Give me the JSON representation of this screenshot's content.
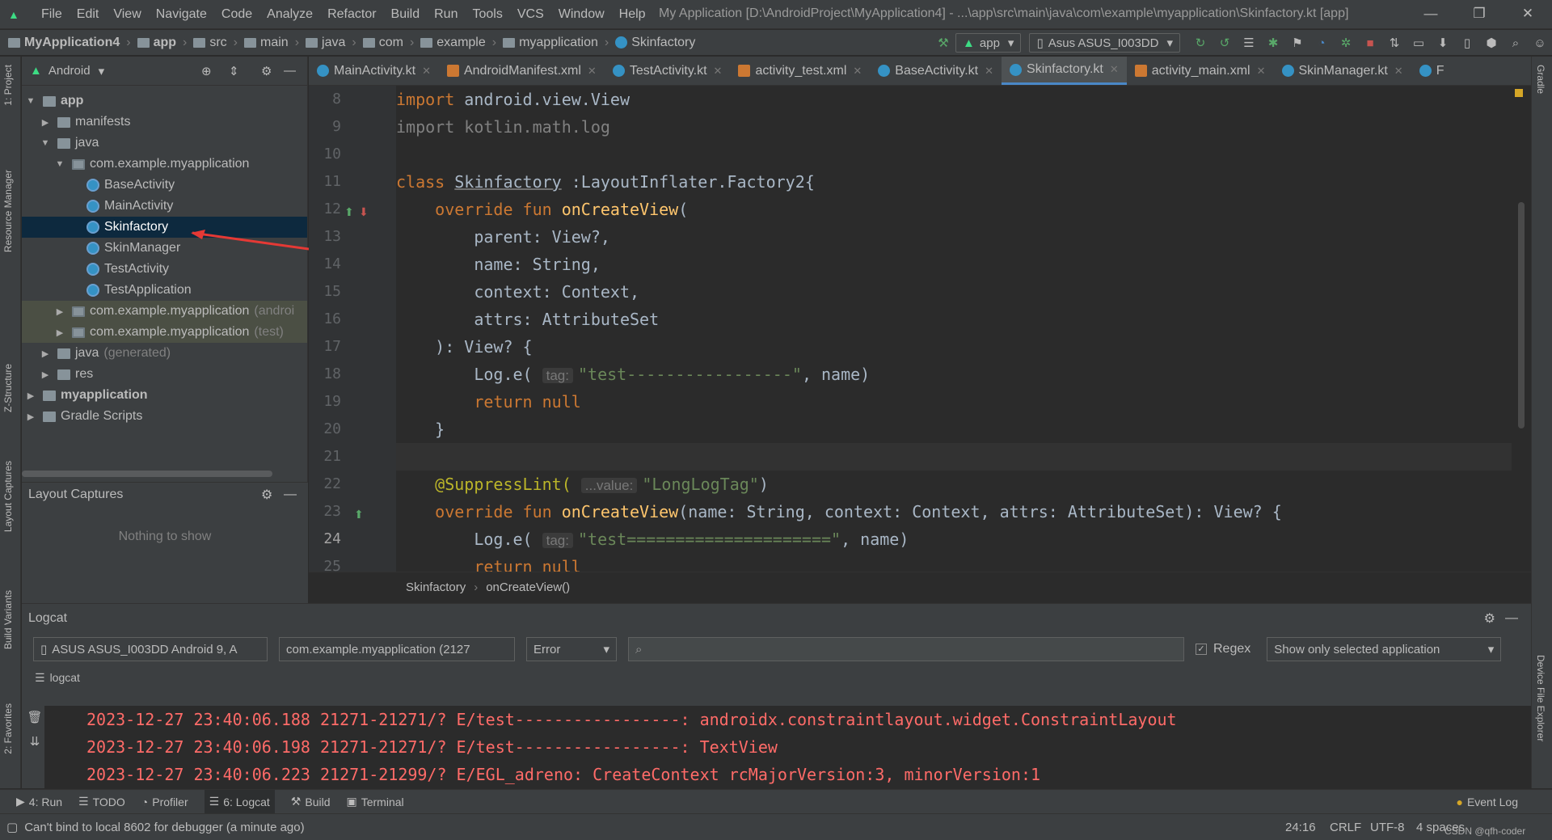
{
  "menu": [
    "File",
    "Edit",
    "View",
    "Navigate",
    "Code",
    "Analyze",
    "Refactor",
    "Build",
    "Run",
    "Tools",
    "VCS",
    "Window",
    "Help"
  ],
  "window_title": "My Application [D:\\AndroidProject\\MyApplication4] - ...\\app\\src\\main\\java\\com\\example\\myapplication\\Skinfactory.kt [app]",
  "nav": [
    "MyApplication4",
    "app",
    "src",
    "main",
    "java",
    "com",
    "example",
    "myapplication",
    "Skinfactory"
  ],
  "toolbar": {
    "run_config": "app",
    "device": "Asus ASUS_I003DD"
  },
  "project": {
    "view_label": "Android",
    "tree": [
      {
        "label": "app",
        "level": 0,
        "arrow": "▼",
        "icon": "fold",
        "bold": true
      },
      {
        "label": "manifests",
        "level": 1,
        "arrow": "▶",
        "icon": "fold"
      },
      {
        "label": "java",
        "level": 1,
        "arrow": "▼",
        "icon": "fold"
      },
      {
        "label": "com.example.myapplication",
        "level": 2,
        "arrow": "▼",
        "icon": "pkg"
      },
      {
        "label": "BaseActivity",
        "level": 3,
        "arrow": "",
        "icon": "cls"
      },
      {
        "label": "MainActivity",
        "level": 3,
        "arrow": "",
        "icon": "cls"
      },
      {
        "label": "Skinfactory",
        "level": 3,
        "arrow": "",
        "icon": "cls",
        "selected": true
      },
      {
        "label": "SkinManager",
        "level": 3,
        "arrow": "",
        "icon": "cls"
      },
      {
        "label": "TestActivity",
        "level": 3,
        "arrow": "",
        "icon": "cls"
      },
      {
        "label": "TestApplication",
        "level": 3,
        "arrow": "",
        "icon": "cls"
      },
      {
        "label": "com.example.myapplication",
        "suffix": "(androi",
        "level": 2,
        "arrow": "▶",
        "icon": "pkg",
        "hl": true
      },
      {
        "label": "com.example.myapplication",
        "suffix": "(test)",
        "level": 2,
        "arrow": "▶",
        "icon": "pkg",
        "hl": true
      },
      {
        "label": "java",
        "suffix": "(generated)",
        "level": 1,
        "arrow": "▶",
        "icon": "fold"
      },
      {
        "label": "res",
        "level": 1,
        "arrow": "▶",
        "icon": "fold"
      },
      {
        "label": "myapplication",
        "level": 0,
        "arrow": "▶",
        "icon": "fold",
        "bold": true
      },
      {
        "label": "Gradle Scripts",
        "level": 0,
        "arrow": "▶",
        "icon": "fold"
      }
    ]
  },
  "captures": {
    "title": "Layout Captures",
    "empty": "Nothing to show"
  },
  "left_tabs": [
    "1: Project",
    "Resource Manager",
    "Z-Structure",
    "Layout Captures",
    "Build Variants",
    "2: Favorites"
  ],
  "right_tabs": [
    "Gradle",
    "Device File Explorer"
  ],
  "editor_tabs": [
    {
      "label": "MainActivity.kt",
      "type": "kt"
    },
    {
      "label": "AndroidManifest.xml",
      "type": "xml"
    },
    {
      "label": "TestActivity.kt",
      "type": "kt"
    },
    {
      "label": "activity_test.xml",
      "type": "xml"
    },
    {
      "label": "BaseActivity.kt",
      "type": "kt"
    },
    {
      "label": "Skinfactory.kt",
      "type": "kt",
      "active": true
    },
    {
      "label": "activity_main.xml",
      "type": "xml"
    },
    {
      "label": "SkinManager.kt",
      "type": "kt"
    },
    {
      "label": "F",
      "type": "kt"
    }
  ],
  "code": {
    "line_numbers": [
      "8",
      "9",
      "10",
      "11",
      "12",
      "13",
      "14",
      "15",
      "16",
      "17",
      "18",
      "19",
      "20",
      "21",
      "22",
      "23",
      "24",
      "25"
    ],
    "current_line": "24",
    "l8": [
      "import",
      "android.view.View"
    ],
    "l9": [
      "import kotlin.math.log"
    ],
    "l11": [
      "class",
      "Skinfactory",
      ":LayoutInflater.Factory2{"
    ],
    "l12": [
      "override fun",
      "onCreateView",
      "("
    ],
    "l13": "parent: View?,",
    "l14": "name: String,",
    "l15": "context: Context,",
    "l16": "attrs: AttributeSet",
    "l17": "): View? {",
    "l18": [
      "Log.e(",
      "tag:",
      "\"test-----------------\"",
      ", name)"
    ],
    "l19": "return null",
    "l20": "}",
    "l22": [
      "@SuppressLint(",
      "...value:",
      "\"LongLogTag\"",
      ")"
    ],
    "l23": [
      "override fun",
      "onCreateView",
      "(name: String,",
      " context: Context,",
      " attrs: AttributeSet): View? {"
    ],
    "l24": [
      "Log.e(",
      "tag:",
      "\"test=====================\"",
      ", name)"
    ],
    "l25": "return null"
  },
  "editor_breadcrumb": [
    "Skinfactory",
    "onCreateView()"
  ],
  "logcat": {
    "title": "Logcat",
    "device": "ASUS ASUS_I003DD Android 9, A",
    "process": "com.example.myapplication (2127",
    "level": "Error",
    "search_placeholder": "",
    "regex_label": "Regex",
    "filter": "Show only selected application",
    "sub_tab": "logcat",
    "lines": [
      "2023-12-27 23:40:06.188 21271-21271/? E/test-----------------: androidx.constraintlayout.widget.ConstraintLayout",
      "2023-12-27 23:40:06.198 21271-21271/? E/test-----------------: TextView",
      "2023-12-27 23:40:06.223 21271-21299/? E/EGL_adreno: CreateContext rcMajorVersion:3, minorVersion:1"
    ]
  },
  "bottom_tabs": [
    {
      "label": "4: Run",
      "icon": "▶"
    },
    {
      "label": "TODO",
      "icon": "☰"
    },
    {
      "label": "Profiler",
      "icon": "◔"
    },
    {
      "label": "6: Logcat",
      "icon": "☰",
      "active": true
    },
    {
      "label": "Build",
      "icon": "⚒"
    },
    {
      "label": "Terminal",
      "icon": "▣"
    }
  ],
  "event_log": "Event Log",
  "status": {
    "message": "Can't bind to local 8602 for debugger (a minute ago)",
    "position": "24:16",
    "line_sep": "CRLF",
    "encoding": "UTF-8",
    "indent": "4 spaces",
    "watermark": "CSDN @qfh-coder"
  },
  "colors": {
    "accent": "#4a88c7",
    "error_log": "#ff6b68",
    "keyword": "#cc7832",
    "function": "#ffc66d",
    "string": "#6a8759",
    "annotation": "#bbb529"
  }
}
